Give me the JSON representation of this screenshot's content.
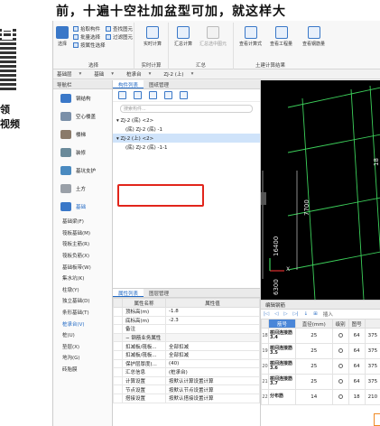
{
  "header": {
    "title": "前，十遍十空社加盆型可加，就这样大"
  },
  "left_strip": {
    "line1": "领",
    "line2": "视频"
  },
  "ribbon": {
    "select_label": "选择",
    "pick_label": "拾取构件",
    "batch_select_label": "批量选择",
    "prop_select_label": "按属性选择",
    "find_label": "查找图元",
    "filter_label": "过滤图元",
    "group_select": "选择",
    "realtime_calc_label": "实时计算",
    "group_realtime": "实时计算",
    "sum_calc_label": "汇总计算",
    "sum_selected_label": "汇总选中图元",
    "group_sum": "汇总",
    "view_formula_label": "查看计算式",
    "view_qty_label": "查看工程量",
    "view_rebar_label": "查看钢筋量",
    "group_results": "土建计算结果"
  },
  "filter_bar": {
    "f1": "基础层",
    "f2": "基础",
    "f3": "桩承台",
    "f4": "ZJ-2 (上)"
  },
  "nav": {
    "title": "导航栏",
    "categories": [
      {
        "label": "钢结构"
      },
      {
        "label": "空心楼盖"
      },
      {
        "label": "楼梯"
      },
      {
        "label": "装修"
      },
      {
        "label": "基坑支护"
      },
      {
        "label": "土方"
      },
      {
        "label": "基础"
      }
    ],
    "subitems": [
      "基础梁(F)",
      "筏板基础(M)",
      "筏板主筋(R)",
      "筏板负筋(X)",
      "基础板带(W)",
      "集水坑(K)",
      "柱墩(Y)",
      "独立基础(D)",
      "条形基础(T)",
      "桩承台(V)",
      "桩(U)",
      "垫层(X)",
      "地沟(G)",
      "砖胎膜"
    ]
  },
  "complist": {
    "tab1": "构件列表",
    "tab2": "图纸管理",
    "search_placeholder": "搜索构件...",
    "tree": [
      {
        "text": "▾ ZJ-2 (底) <2>",
        "indent": 0,
        "sel": false
      },
      {
        "text": "(底) ZJ-2 (底) -1",
        "indent": 1,
        "sel": false
      },
      {
        "text": "▾ ZJ-2 (上) <2>",
        "indent": 0,
        "sel": true
      },
      {
        "text": "(底) ZJ-2 (底) -1-1",
        "indent": 1,
        "sel": false
      }
    ]
  },
  "props": {
    "tab1": "属性列表",
    "tab2": "图层管理",
    "col_name": "属性名称",
    "col_value": "属性值",
    "rows": [
      {
        "idx": "",
        "name": "顶标高(m)",
        "value": "-1.8",
        "group": false
      },
      {
        "idx": "",
        "name": "底标高(m)",
        "value": "-2.3",
        "group": false
      },
      {
        "idx": "",
        "name": "备注",
        "value": "",
        "group": false
      },
      {
        "idx": "",
        "name": "− 钢筋业务属性",
        "value": "",
        "group": true
      },
      {
        "idx": "",
        "name": "扣减板/筏板...",
        "value": "全部扣减",
        "group": false
      },
      {
        "idx": "",
        "name": "扣减板/筏板...",
        "value": "全部扣减",
        "group": false
      },
      {
        "idx": "",
        "name": "保护层厚度(...",
        "value": "(40)",
        "group": false
      },
      {
        "idx": "",
        "name": "汇总信息",
        "value": "(桩承台)",
        "group": false
      },
      {
        "idx": "",
        "name": "计算设置",
        "value": "按默认计算设置计算",
        "group": false
      },
      {
        "idx": "",
        "name": "节点设置",
        "value": "按默认节点设置计算",
        "group": false
      },
      {
        "idx": "",
        "name": "搭接设置",
        "value": "按默认搭接设置计算",
        "group": false
      }
    ]
  },
  "viewport": {
    "dim1": "7700",
    "dim2": "16400",
    "dim3": "6300",
    "dim4": "18",
    "axis_x": "X"
  },
  "rebar": {
    "title": "编辑钢筋",
    "insert_label": "插入",
    "headers": [
      "筋号",
      "直径(mm)",
      "级别",
      "图号"
    ],
    "rows": [
      {
        "idx": "18",
        "name": "桩间连接筋3.4",
        "dia": "25",
        "code": "64",
        "len": "375"
      },
      {
        "idx": "19",
        "name": "桩间连接筋3.5",
        "dia": "25",
        "code": "64",
        "len": "375"
      },
      {
        "idx": "20",
        "name": "桩间连接筋3.6",
        "dia": "25",
        "code": "64",
        "len": "375"
      },
      {
        "idx": "21",
        "name": "桩间连接筋3.7",
        "dia": "25",
        "code": "64",
        "len": "375"
      },
      {
        "idx": "22",
        "name": "分布筋",
        "dia": "14",
        "code": "18",
        "len": "210"
      }
    ]
  }
}
